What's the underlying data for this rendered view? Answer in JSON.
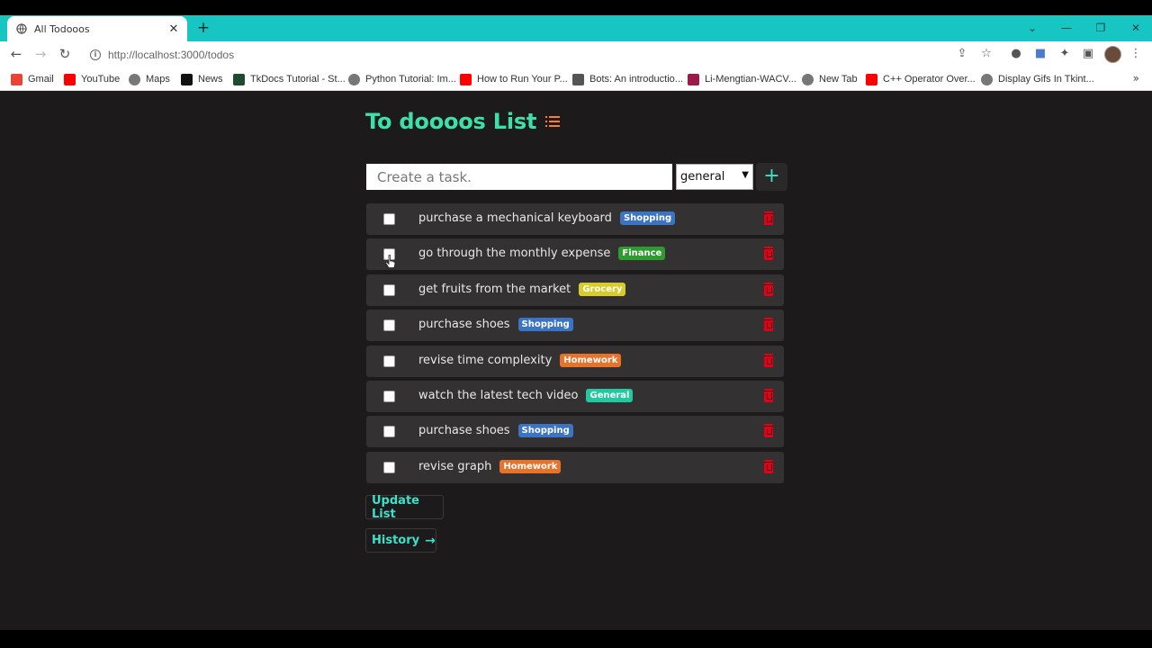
{
  "browser": {
    "tab_title": "All Todooos",
    "url": "http://localhost:3000/todos",
    "bookmarks": [
      {
        "label": "Gmail",
        "icon": "gmail-icon",
        "color": "#ea4335"
      },
      {
        "label": "YouTube",
        "icon": "youtube-icon",
        "color": "#ff0000"
      },
      {
        "label": "Maps",
        "icon": "globe-icon",
        "color": "#666666"
      },
      {
        "label": "News",
        "icon": "news-icon",
        "color": "#111111"
      },
      {
        "label": "TkDocs Tutorial - St...",
        "icon": "tkdocs-icon",
        "color": "#1f4b2f"
      },
      {
        "label": "Python Tutorial: Im...",
        "icon": "globe-icon",
        "color": "#666666"
      },
      {
        "label": "How to Run Your P...",
        "icon": "youtube-icon",
        "color": "#ff0000"
      },
      {
        "label": "Bots: An introductio...",
        "icon": "bot-icon",
        "color": "#555555"
      },
      {
        "label": "Li-Mengtian-WACV...",
        "icon": "magnet-icon",
        "color": "#9b1b4a"
      },
      {
        "label": "New Tab",
        "icon": "globe-icon",
        "color": "#666666"
      },
      {
        "label": "C++ Operator Over...",
        "icon": "youtube-icon",
        "color": "#ff0000"
      },
      {
        "label": "Display Gifs In Tkint...",
        "icon": "globe-icon",
        "color": "#666666"
      }
    ],
    "more_bookmarks": "»"
  },
  "app": {
    "title": "To doooos List",
    "input_placeholder": "Create a task.",
    "category_selected": "general",
    "add_label": "+",
    "update_label": "Update List",
    "history_label": "History",
    "accent_color": "#3de0a8"
  },
  "todos": [
    {
      "text": "purchase a mechanical keyboard",
      "tag": "Shopping",
      "tag_color": "#3b74c4"
    },
    {
      "text": "go through the monthly expense",
      "tag": "Finance",
      "tag_color": "#2e9b2e"
    },
    {
      "text": "get fruits from the market",
      "tag": "Grocery",
      "tag_color": "#d8cc2a"
    },
    {
      "text": "purchase shoes",
      "tag": "Shopping",
      "tag_color": "#3b74c4"
    },
    {
      "text": "revise time complexity",
      "tag": "Homework",
      "tag_color": "#e8722a"
    },
    {
      "text": "watch the latest tech video",
      "tag": "General",
      "tag_color": "#22c9a0"
    },
    {
      "text": "purchase shoes",
      "tag": "Shopping",
      "tag_color": "#3b74c4"
    },
    {
      "text": "revise graph",
      "tag": "Homework",
      "tag_color": "#e8722a"
    }
  ]
}
